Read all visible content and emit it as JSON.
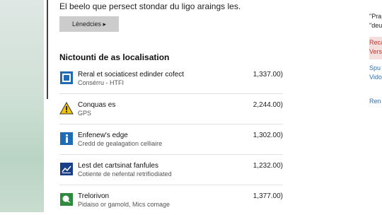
{
  "intro_text": "El beelo que persect stondar du ligo araings les.",
  "download_button": "Lénedcies ▸",
  "section_title": "Nictounti de as localisation",
  "items": [
    {
      "title": "Reral et sociaticest edinder cofect",
      "subtitle": "Consérru - HTFI",
      "size": "1,337.00)",
      "icon": "store-icon",
      "color": "#1f6bb4"
    },
    {
      "title": "Conquas es",
      "subtitle": "GPS",
      "size": "2,244.00)",
      "icon": "warning-icon",
      "color": "#f2c300"
    },
    {
      "title": "Enfenew's edge",
      "subtitle": "Credd de gealagation celliaire",
      "size": "1,302.00)",
      "icon": "info-icon",
      "color": "#1f6bb4"
    },
    {
      "title": "Lest det cartsinat fanfules",
      "subtitle": "Cotiente de nefental retrifiodiated",
      "size": "1,232.00)",
      "icon": "map-icon",
      "color": "#1a3f8a"
    },
    {
      "title": "Trelorivon",
      "subtitle": "Pidaiso or gamold, Mics comage",
      "size": "1,377.00)",
      "icon": "chat-icon",
      "color": "#2e8b3d"
    }
  ],
  "right_panel": {
    "line1": "\"Pra",
    "line2": "\"deu",
    "red1": "Reca",
    "red2": "Vers",
    "blue1": "Spu",
    "blue2": "Vido",
    "blue3": "Ren"
  }
}
